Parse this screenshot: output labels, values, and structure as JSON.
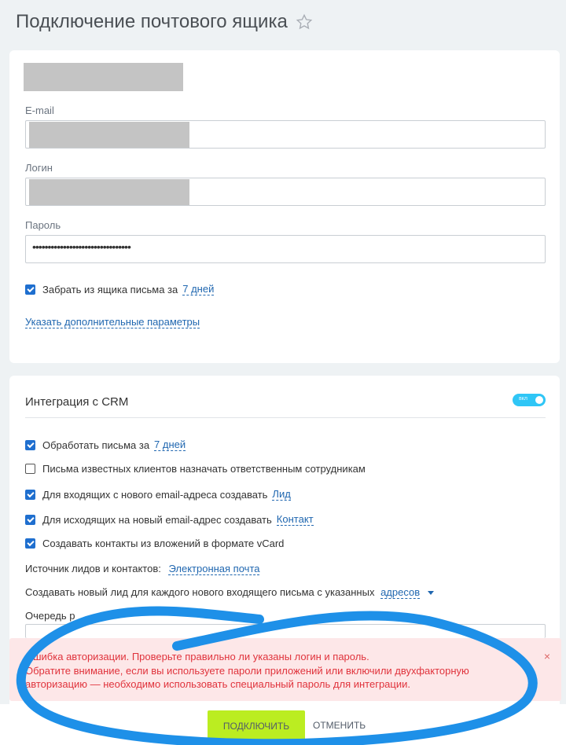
{
  "header": {
    "title": "Подключение почтового ящика",
    "favorite_icon": "star-icon"
  },
  "mailbox": {
    "email_label": "E-mail",
    "login_label": "Логин",
    "password_label": "Пароль",
    "password_value": "••••••••••••••••••••••••••••••••",
    "fetch_label": "Забрать из ящика письма за",
    "fetch_period": "7 дней",
    "advanced_link": "Указать дополнительные параметры"
  },
  "crm": {
    "title": "Интеграция с CRM",
    "toggle_label": "вкл",
    "process_label": "Обработать письма за",
    "process_period": "7 дней",
    "assign_label": "Письма известных клиентов назначать ответственным сотрудникам",
    "incoming_label": "Для входящих с нового email-адреса создавать",
    "incoming_value": "Лид",
    "outgoing_label": "Для исходящих на новый email-адрес создавать",
    "outgoing_value": "Контакт",
    "vcard_label": "Создавать контакты из вложений в формате vCard",
    "source_label": "Источник лидов и контактов:",
    "source_value": "Электронная почта",
    "new_lead_label": "Создавать новый лид для каждого нового входящего письма с указанных",
    "new_lead_value": "адресов",
    "queue_label": "Очередь р"
  },
  "error": {
    "line1": "Ошибка авторизации. Проверьте правильно ли указаны логин и пароль.",
    "line2": "Обратите внимание, если вы используете пароли приложений или включили двухфакторную",
    "line3": "авторизацию — необходимо использовать специальный пароль для интеграции.",
    "close": "×"
  },
  "actions": {
    "connect": "ПОДКЛЮЧИТЬ",
    "cancel": "ОТМЕНИТЬ"
  },
  "colors": {
    "accent": "#2067b0",
    "checkbox": "#1f6fcf",
    "toggle": "#2fc6f6",
    "connect_button": "#bbed21",
    "error_text": "#e0333c",
    "error_bg": "#fde7e8",
    "annotation": "#1e90e8"
  }
}
